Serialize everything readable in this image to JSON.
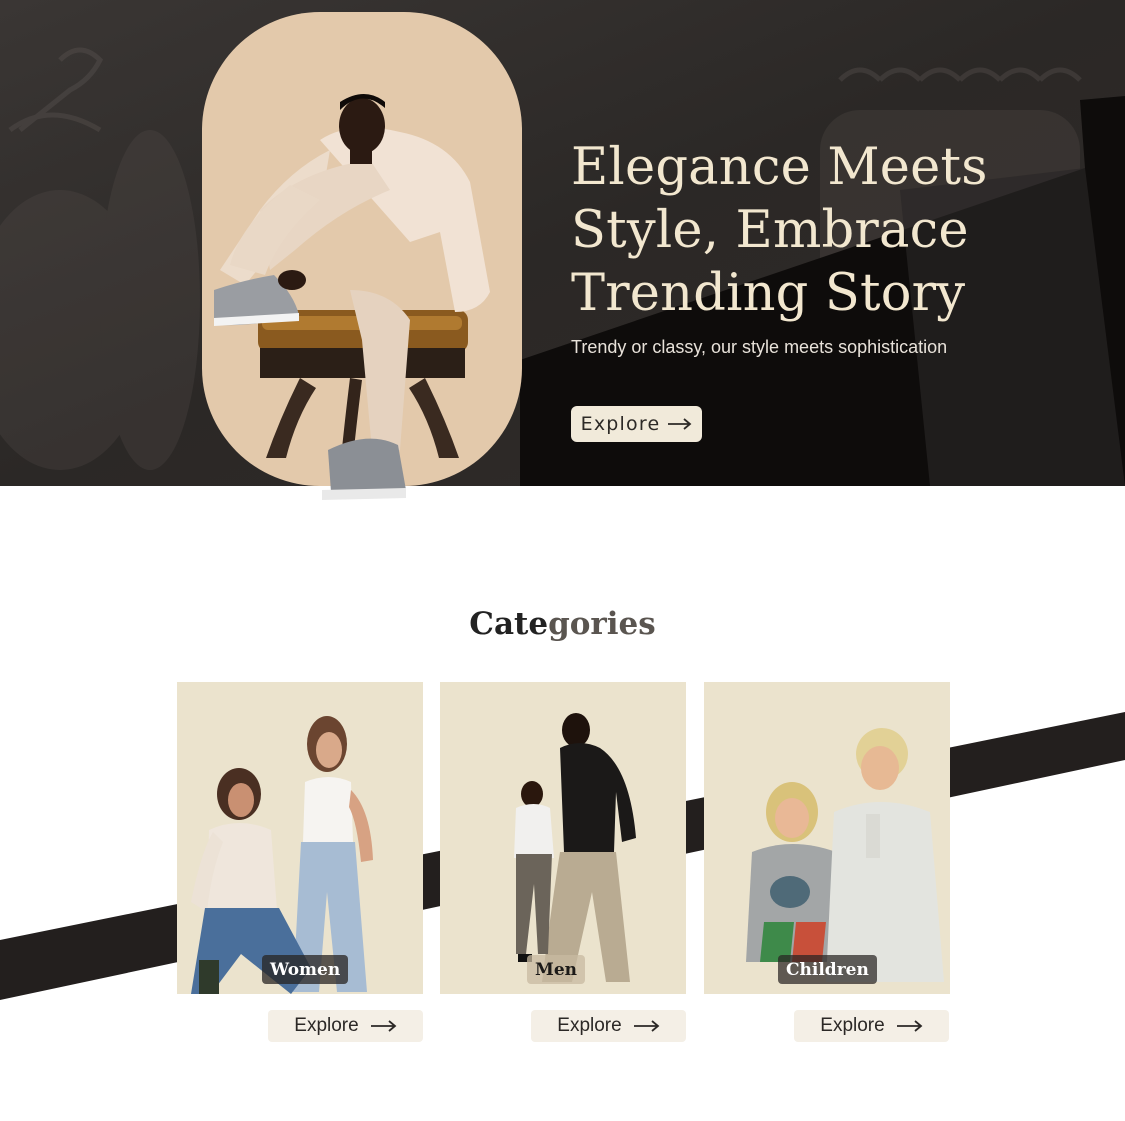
{
  "hero": {
    "title": "Elegance Meets Style, Embrace Trending Story",
    "subtitle": "Trendy or classy, our style meets sophistication",
    "cta_label": "Explore",
    "cta_icon": "arrow-right-icon",
    "image": "man-in-cream-suit-sitting-on-stool"
  },
  "categories": {
    "title_dark": "Cate",
    "title_light": "gories",
    "items": [
      {
        "label": "Women",
        "cta_label": "Explore",
        "image": "two-women-casual-denim"
      },
      {
        "label": "Men",
        "cta_label": "Explore",
        "image": "two-men-formal-wear"
      },
      {
        "label": "Children",
        "cta_label": "Explore",
        "image": "two-kids-smiling"
      }
    ]
  },
  "colors": {
    "hero_background": "#2a2827",
    "portrait_background": "#e3c9ab",
    "hero_title": "#f2e7cf",
    "card_background": "#ebe3cd",
    "accent_dark": "#231f1e",
    "button_background": "#f1eada"
  }
}
